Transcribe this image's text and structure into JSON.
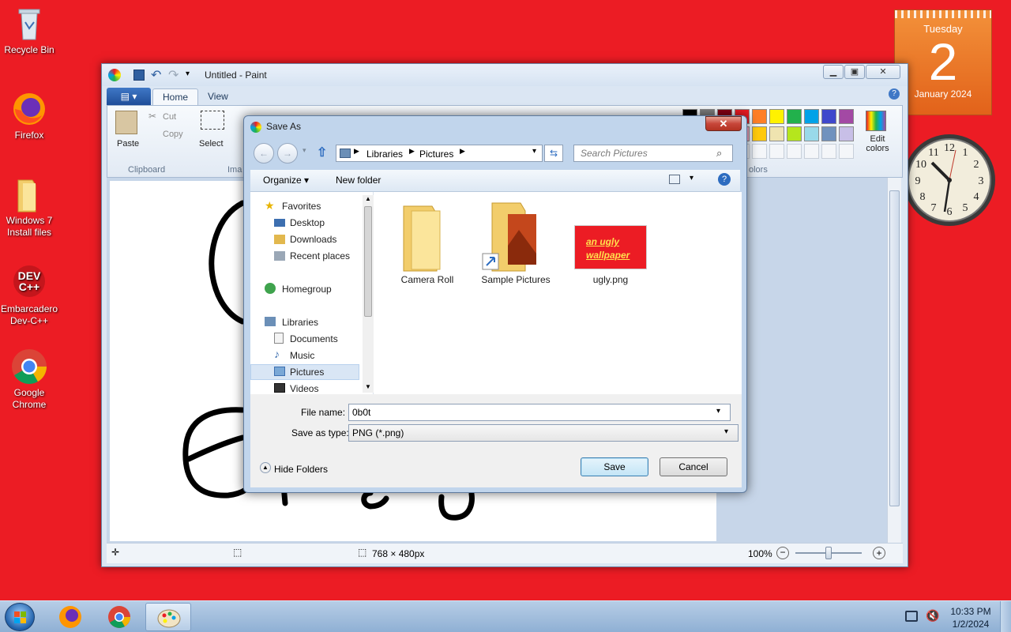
{
  "desktop": {
    "icons": [
      {
        "label": "Recycle Bin"
      },
      {
        "label": "Firefox"
      },
      {
        "label": "Windows 7 Install files"
      },
      {
        "label": "Embarcadero Dev-C++"
      },
      {
        "label": "Google Chrome"
      }
    ]
  },
  "calendar": {
    "weekday": "Tuesday",
    "day": "2",
    "month_year": "January 2024"
  },
  "clock": {
    "numerals": [
      "12",
      "1",
      "2",
      "3",
      "4",
      "5",
      "6",
      "7",
      "8",
      "9",
      "10",
      "11"
    ]
  },
  "paint": {
    "title": "Untitled - Paint",
    "tabs": [
      "Home",
      "View"
    ],
    "clipboard": {
      "paste": "Paste",
      "cut": "Cut",
      "copy": "Copy",
      "group": "Clipboard"
    },
    "image": {
      "select": "Select",
      "group": "Ima"
    },
    "colors": {
      "edit": "Edit colors",
      "group": "olors"
    },
    "status": {
      "size": "768 × 480px",
      "zoom": "100%"
    },
    "palette_row1": [
      "#000000",
      "#7f7f7f",
      "#880015",
      "#ed1c24",
      "#ff7f27",
      "#fff200",
      "#22b14c",
      "#00a2e8",
      "#3f48cc",
      "#a349a4"
    ],
    "palette_row2": [
      "#ffffff",
      "#c3c3c3",
      "#b97a57",
      "#ffaec9",
      "#ffc90e",
      "#efe4b0",
      "#b5e61d",
      "#99d9ea",
      "#7092be",
      "#c8bfe7"
    ]
  },
  "dialog": {
    "title": "Save As",
    "breadcrumb": [
      "Libraries",
      "Pictures"
    ],
    "search_placeholder": "Search Pictures",
    "organize": "Organize",
    "new_folder": "New folder",
    "nav": {
      "favorites": "Favorites",
      "desktop": "Desktop",
      "downloads": "Downloads",
      "recent": "Recent places",
      "homegroup": "Homegroup",
      "libraries": "Libraries",
      "documents": "Documents",
      "music": "Music",
      "pictures": "Pictures",
      "videos": "Videos"
    },
    "files": [
      {
        "name": "Camera Roll"
      },
      {
        "name": "Sample Pictures"
      },
      {
        "name": "ugly.png",
        "thumb_text": "an ugly wallpaper"
      }
    ],
    "file_name_label": "File name:",
    "file_name_value": "0b0t",
    "save_type_label": "Save as type:",
    "save_type_value": "PNG (*.png)",
    "hide_folders": "Hide Folders",
    "save": "Save",
    "cancel": "Cancel"
  },
  "taskbar": {
    "time": "10:33 PM",
    "date": "1/2/2024"
  }
}
